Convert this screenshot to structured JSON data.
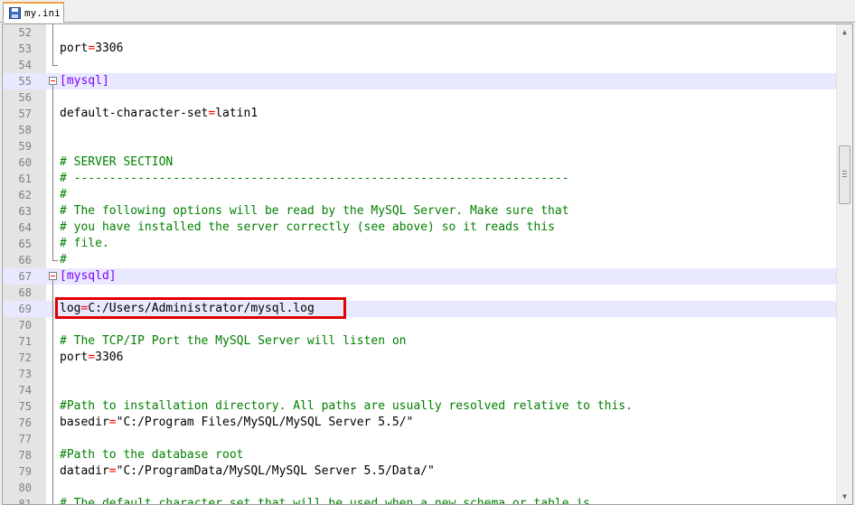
{
  "tab": {
    "filename": "my.ini"
  },
  "lines": [
    {
      "n": "52",
      "parts": []
    },
    {
      "n": "53",
      "parts": [
        {
          "t": "port",
          "c": "key"
        },
        {
          "t": "=",
          "c": "op"
        },
        {
          "t": "3306",
          "c": "val"
        }
      ]
    },
    {
      "n": "54",
      "parts": []
    },
    {
      "n": "55",
      "parts": [
        {
          "t": "[mysql]",
          "c": "section"
        }
      ],
      "hl": true,
      "fold": "start"
    },
    {
      "n": "56",
      "parts": []
    },
    {
      "n": "57",
      "parts": [
        {
          "t": "default-character-set",
          "c": "key"
        },
        {
          "t": "=",
          "c": "op"
        },
        {
          "t": "latin1",
          "c": "val"
        }
      ]
    },
    {
      "n": "58",
      "parts": []
    },
    {
      "n": "59",
      "parts": []
    },
    {
      "n": "60",
      "parts": [
        {
          "t": "# SERVER SECTION",
          "c": "comment"
        }
      ]
    },
    {
      "n": "61",
      "parts": [
        {
          "t": "# ----------------------------------------------------------------------",
          "c": "comment"
        }
      ]
    },
    {
      "n": "62",
      "parts": [
        {
          "t": "#",
          "c": "comment"
        }
      ]
    },
    {
      "n": "63",
      "parts": [
        {
          "t": "# The following options will be read by the MySQL Server. Make sure that",
          "c": "comment"
        }
      ]
    },
    {
      "n": "64",
      "parts": [
        {
          "t": "# you have installed the server correctly (see above) so it reads this",
          "c": "comment"
        }
      ]
    },
    {
      "n": "65",
      "parts": [
        {
          "t": "# file.",
          "c": "comment"
        }
      ]
    },
    {
      "n": "66",
      "parts": [
        {
          "t": "#",
          "c": "comment"
        }
      ],
      "fold": "end"
    },
    {
      "n": "67",
      "parts": [
        {
          "t": "[mysqld]",
          "c": "section"
        }
      ],
      "hl": true,
      "fold": "start"
    },
    {
      "n": "68",
      "parts": []
    },
    {
      "n": "69",
      "parts": [
        {
          "t": "log",
          "c": "key"
        },
        {
          "t": "=",
          "c": "op"
        },
        {
          "t": "C:/Users/Administrator/mysql.log",
          "c": "val"
        }
      ],
      "hl": true
    },
    {
      "n": "70",
      "parts": []
    },
    {
      "n": "71",
      "parts": [
        {
          "t": "# The TCP/IP Port the MySQL Server will listen on",
          "c": "comment"
        }
      ]
    },
    {
      "n": "72",
      "parts": [
        {
          "t": "port",
          "c": "key"
        },
        {
          "t": "=",
          "c": "op"
        },
        {
          "t": "3306",
          "c": "val"
        }
      ]
    },
    {
      "n": "73",
      "parts": []
    },
    {
      "n": "74",
      "parts": []
    },
    {
      "n": "75",
      "parts": [
        {
          "t": "#Path to installation directory. All paths are usually resolved relative to this.",
          "c": "comment"
        }
      ]
    },
    {
      "n": "76",
      "parts": [
        {
          "t": "basedir",
          "c": "key"
        },
        {
          "t": "=",
          "c": "op"
        },
        {
          "t": "\"C:/Program Files/MySQL/MySQL Server 5.5/\"",
          "c": "val"
        }
      ]
    },
    {
      "n": "77",
      "parts": []
    },
    {
      "n": "78",
      "parts": [
        {
          "t": "#Path to the database root",
          "c": "comment"
        }
      ]
    },
    {
      "n": "79",
      "parts": [
        {
          "t": "datadir",
          "c": "key"
        },
        {
          "t": "=",
          "c": "op"
        },
        {
          "t": "\"C:/ProgramData/MySQL/MySQL Server 5.5/Data/\"",
          "c": "val"
        }
      ]
    },
    {
      "n": "80",
      "parts": []
    },
    {
      "n": "81",
      "parts": [
        {
          "t": "# The default character set that will be used when a new schema or table is",
          "c": "comment"
        }
      ]
    }
  ]
}
